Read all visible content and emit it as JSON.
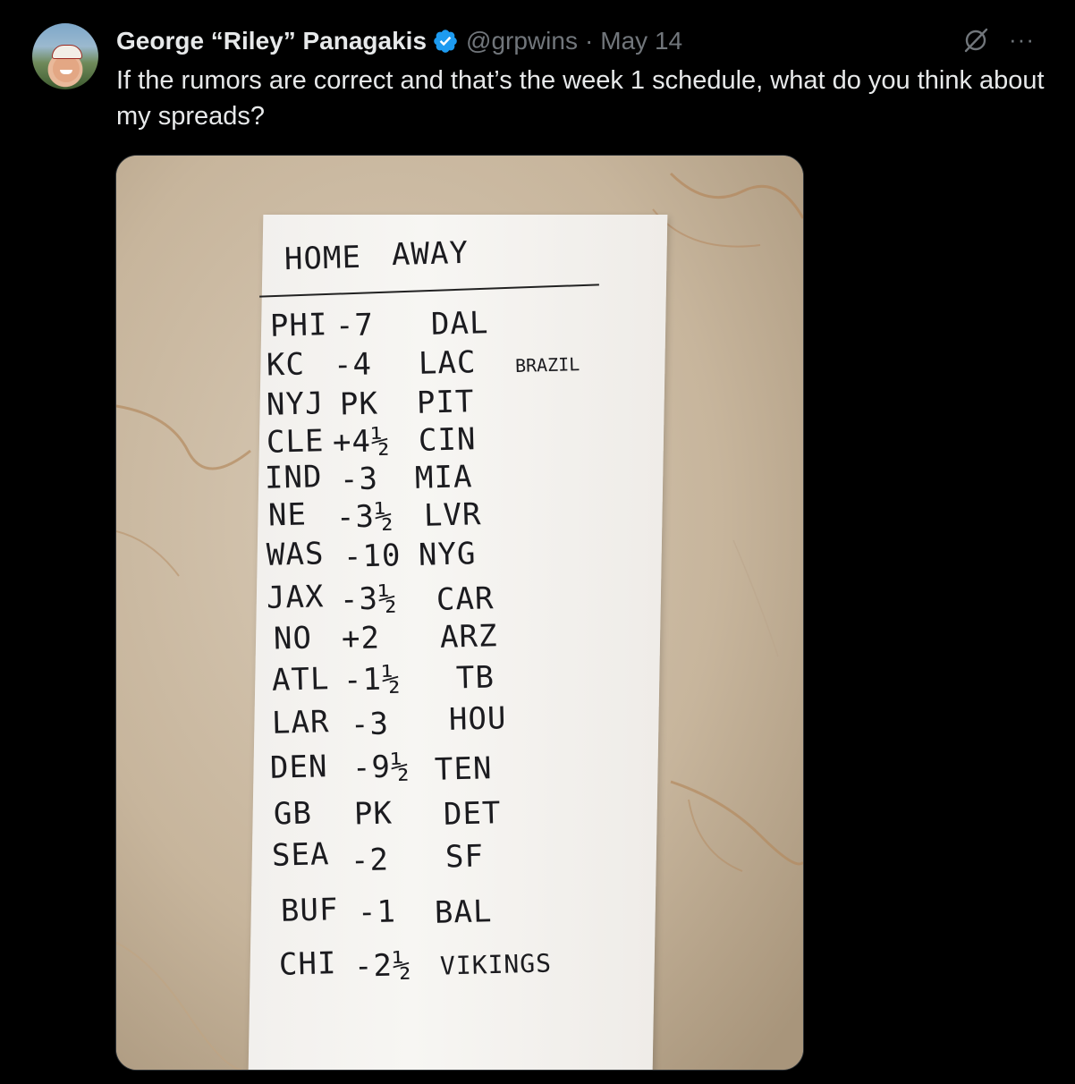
{
  "tweet": {
    "author_name": "George “Riley” Panagakis",
    "handle": "@grpwins",
    "separator": "·",
    "date": "May 14",
    "text": "If the rumors are correct and that’s the week 1 schedule, what do you think about my spreads?",
    "more_label": "···"
  },
  "colors": {
    "background": "#000000",
    "text_primary": "#e7e9ea",
    "text_secondary": "#71767b",
    "verified_badge": "#1d9bf0"
  },
  "icons": {
    "verified": "verified-badge-icon",
    "grok": "grok-icon",
    "more": "more-icon"
  },
  "note": {
    "header_home": "HOME",
    "header_away": "AWAY",
    "side_note": "BRAZIL",
    "rows": [
      {
        "home": "PHI",
        "spread": "-7",
        "away": "DAL"
      },
      {
        "home": "KC",
        "spread": "-4",
        "away": "LAC"
      },
      {
        "home": "NYJ",
        "spread": "PK",
        "away": "PIT"
      },
      {
        "home": "CLE",
        "spread": "+4½",
        "away": "CIN"
      },
      {
        "home": "IND",
        "spread": "-3",
        "away": "MIA"
      },
      {
        "home": "NE",
        "spread": "-3½",
        "away": "LVR"
      },
      {
        "home": "WAS",
        "spread": "-10",
        "away": "NYG"
      },
      {
        "home": "JAX",
        "spread": "-3½",
        "away": "CAR"
      },
      {
        "home": "NO",
        "spread": "+2",
        "away": "ARZ"
      },
      {
        "home": "ATL",
        "spread": "-1½",
        "away": "TB"
      },
      {
        "home": "LAR",
        "spread": "-3",
        "away": "HOU"
      },
      {
        "home": "DEN",
        "spread": "-9½",
        "away": "TEN"
      },
      {
        "home": "GB",
        "spread": "PK",
        "away": "DET"
      },
      {
        "home": "SEA",
        "spread": "-2",
        "away": "SF"
      },
      {
        "home": "BUF",
        "spread": "-1",
        "away": "BAL"
      },
      {
        "home": "CHI",
        "spread": "-2½",
        "away": "VIKINGS"
      }
    ]
  }
}
